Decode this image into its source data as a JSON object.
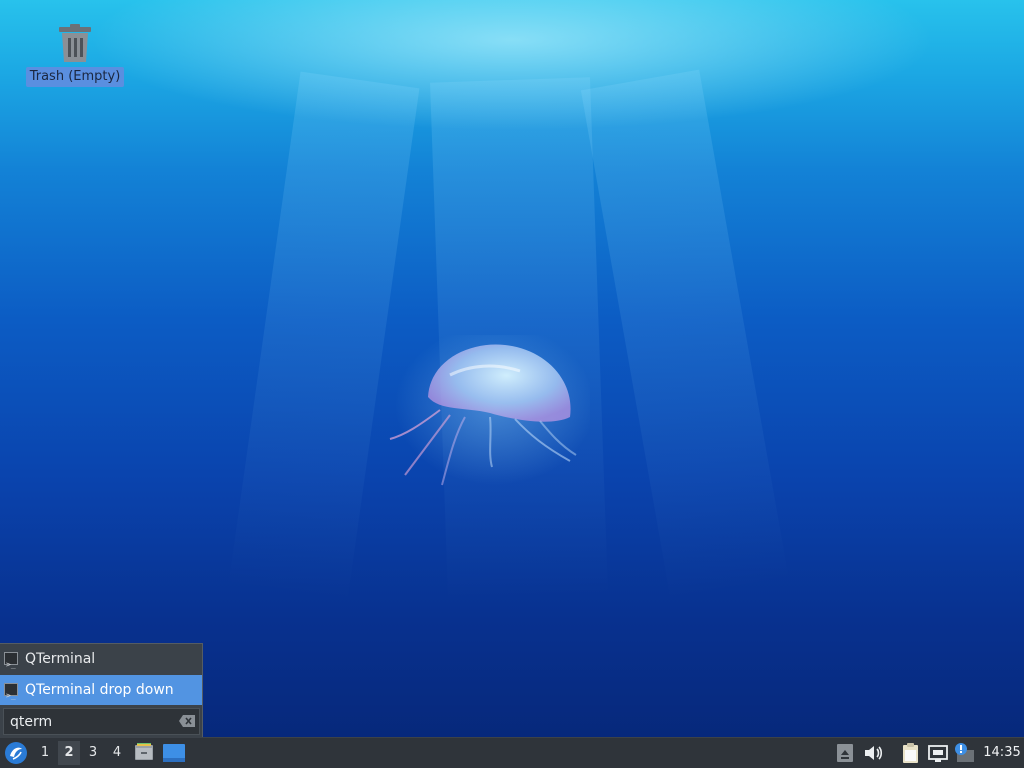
{
  "desktop": {
    "icons": [
      {
        "label": "Trash (Empty)",
        "icon": "trash-icon"
      }
    ]
  },
  "launcher": {
    "results": [
      {
        "label": "QTerminal",
        "icon": "terminal-icon",
        "selected": false
      },
      {
        "label": "QTerminal drop down",
        "icon": "terminal-icon",
        "selected": true
      }
    ],
    "search": {
      "value": "qterm",
      "clear_icon": "clear-text-icon"
    }
  },
  "taskbar": {
    "menu_icon": "lxqt-menu-icon",
    "desktops": [
      "1",
      "2",
      "3",
      "4"
    ],
    "active_desktop": "2",
    "quicklaunch": [
      {
        "icon": "file-manager-icon"
      },
      {
        "icon": "show-desktop-icon"
      }
    ],
    "tray": [
      {
        "icon": "tray-expand-icon"
      },
      {
        "icon": "volume-icon"
      },
      {
        "icon": "clipboard-icon"
      },
      {
        "icon": "network-icon"
      },
      {
        "icon": "update-notifier-icon"
      }
    ],
    "clock": "14:35"
  },
  "colors": {
    "selection": "#5294e2",
    "panel": "#2f343a",
    "launcher_bg": "#3b4249"
  }
}
